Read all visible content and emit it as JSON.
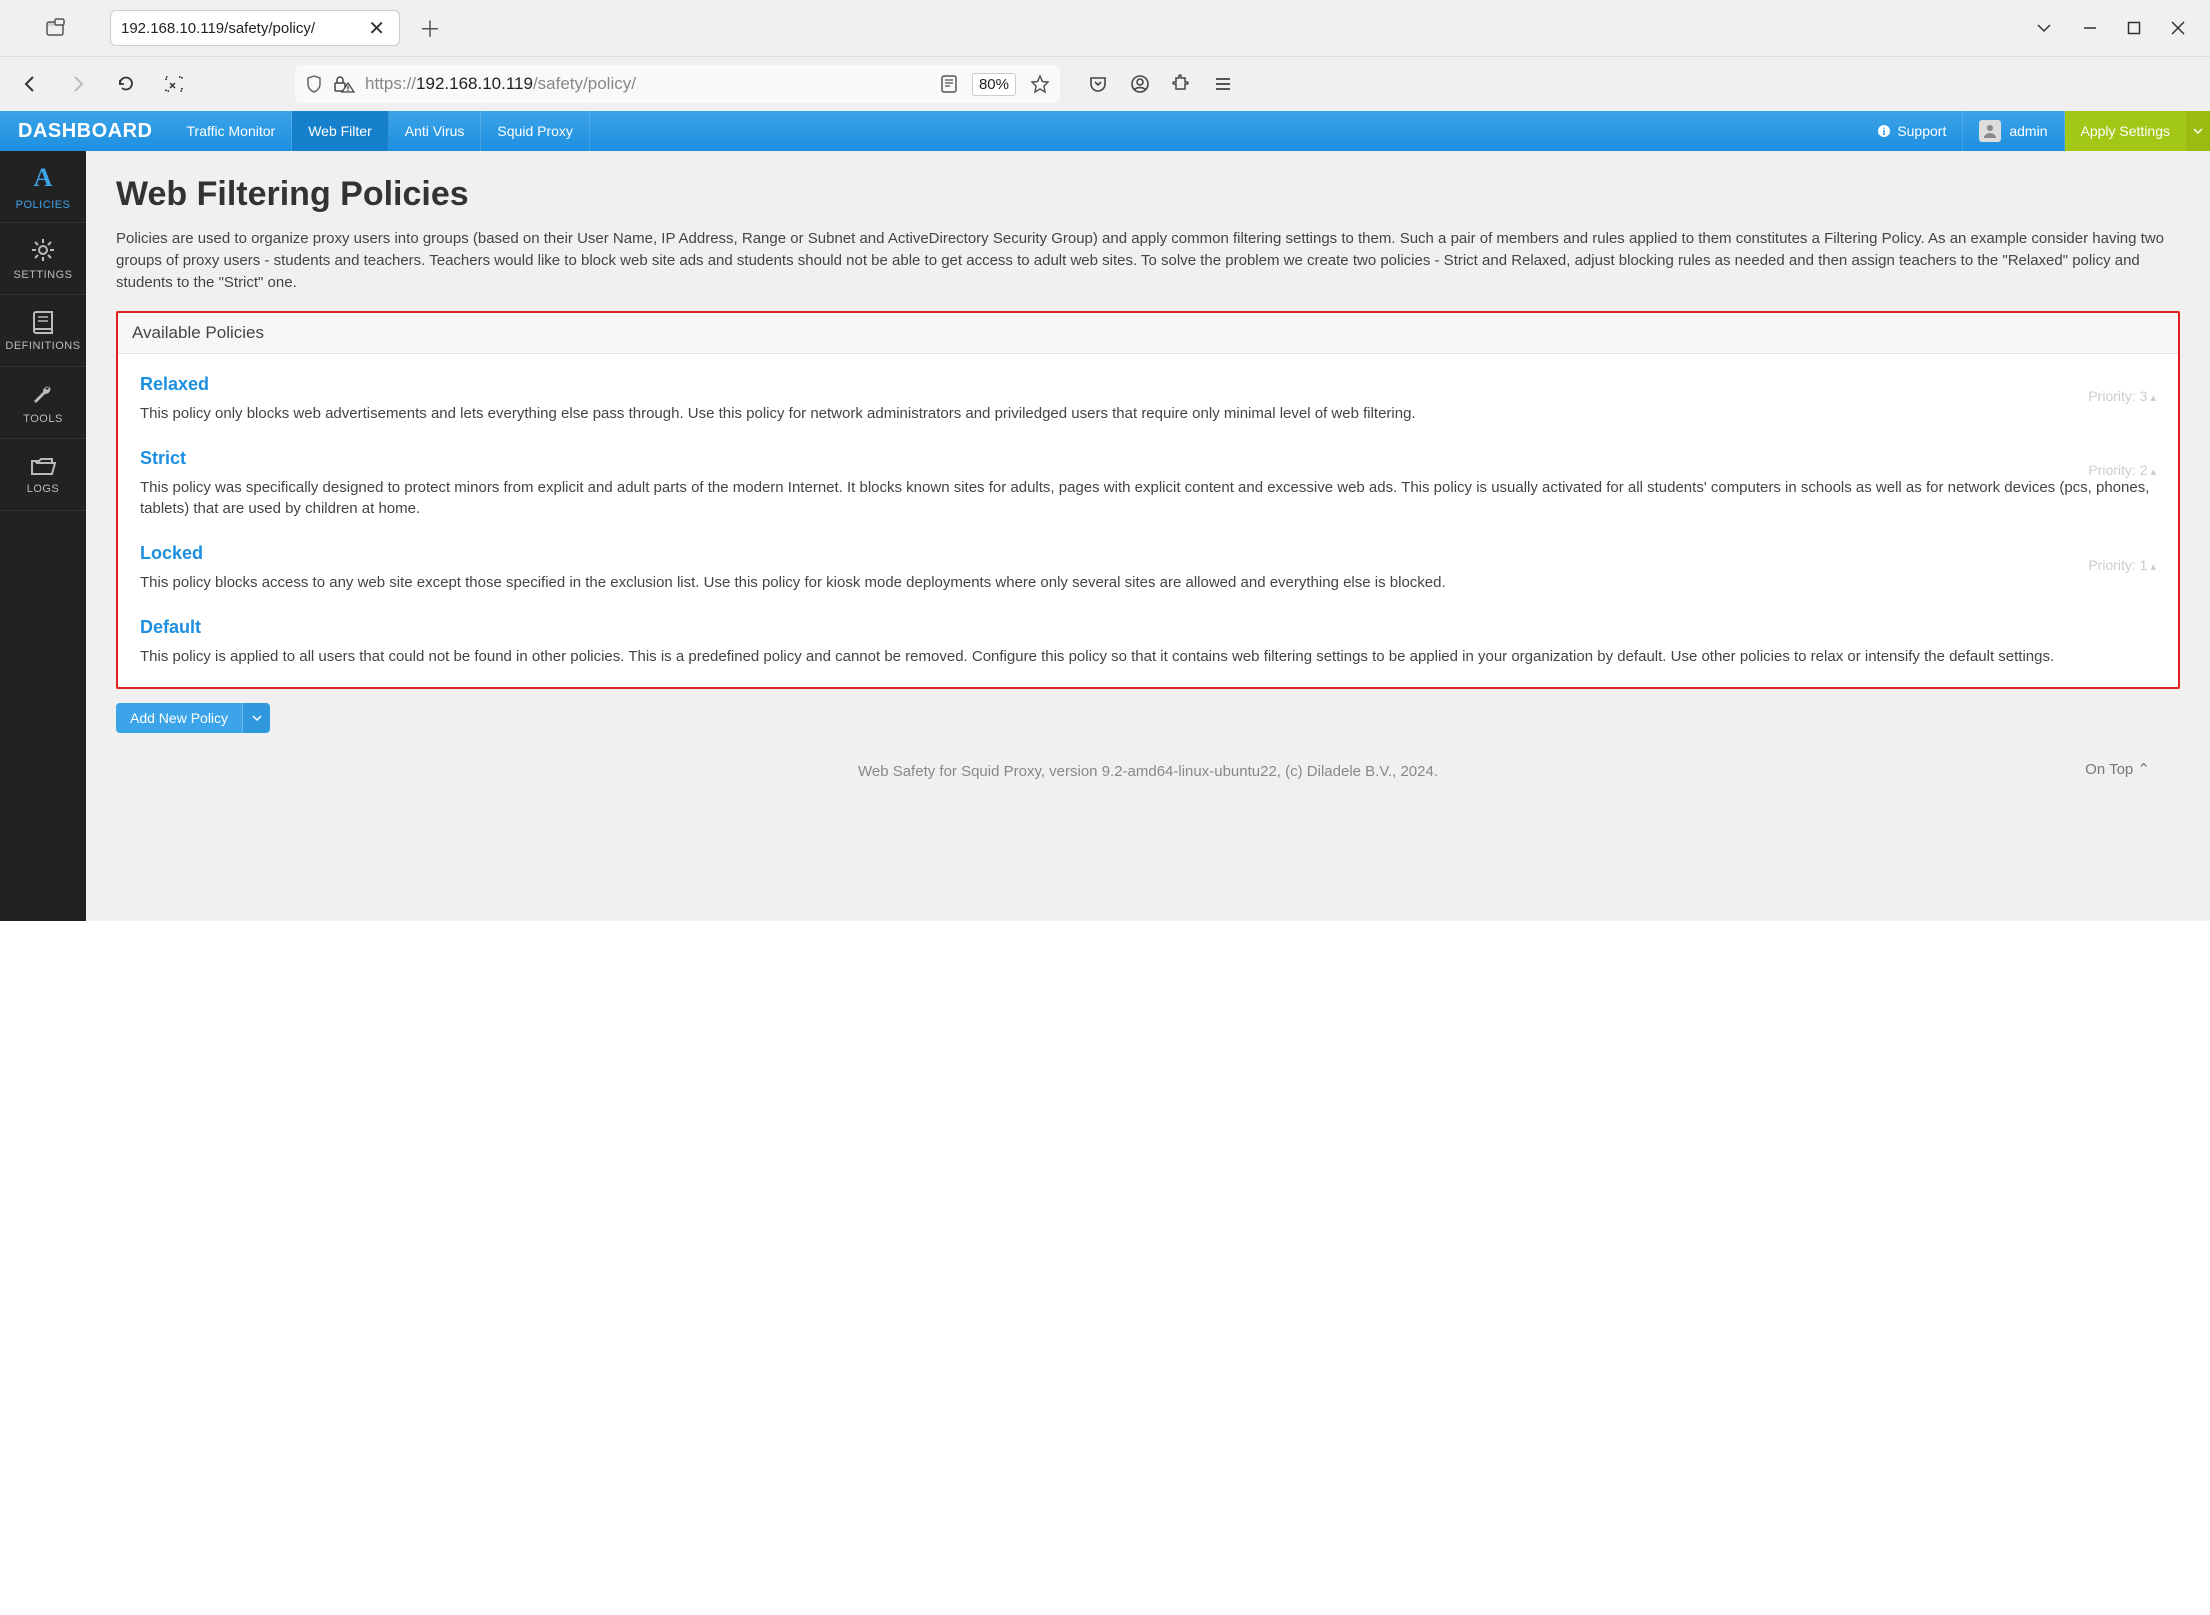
{
  "browser": {
    "tab_title": "192.168.10.119/safety/policy/",
    "url_prefix": "https://",
    "url_host": "192.168.10.119",
    "url_path": "/safety/policy/",
    "zoom": "80%"
  },
  "topnav": {
    "brand": "DASHBOARD",
    "tabs": [
      "Traffic Monitor",
      "Web Filter",
      "Anti Virus",
      "Squid Proxy"
    ],
    "active_tab_index": 1,
    "support": "Support",
    "user": "admin",
    "apply": "Apply Settings"
  },
  "sidebar": {
    "items": [
      {
        "label": "POLICIES",
        "icon": "A"
      },
      {
        "label": "SETTINGS",
        "icon": "gear"
      },
      {
        "label": "DEFINITIONS",
        "icon": "book"
      },
      {
        "label": "TOOLS",
        "icon": "wrench"
      },
      {
        "label": "LOGS",
        "icon": "folder"
      }
    ],
    "active_index": 0
  },
  "page": {
    "title": "Web Filtering Policies",
    "description": "Policies are used to organize proxy users into groups (based on their User Name, IP Address, Range or Subnet and ActiveDirectory Security Group) and apply common filtering settings to them. Such a pair of members and rules applied to them constitutes a Filtering Policy. As an example consider having two groups of proxy users - students and teachers. Teachers would like to block web site ads and students should not be able to get access to adult web sites. To solve the problem we create two policies - Strict and Relaxed, adjust blocking rules as needed and then assign teachers to the \"Relaxed\" policy and students to the \"Strict\" one.",
    "panel_title": "Available Policies",
    "policies": [
      {
        "name": "Relaxed",
        "priority": "Priority: 3",
        "desc": "This policy only blocks web advertisements and lets everything else pass through. Use this policy for network administrators and priviledged users that require only minimal level of web filtering."
      },
      {
        "name": "Strict",
        "priority": "Priority: 2",
        "desc": "This policy was specifically designed to protect minors from explicit and adult parts of the modern Internet. It blocks known sites for adults, pages with explicit content and excessive web ads. This policy is usually activated for all students' computers in schools as well as for network devices (pcs, phones, tablets) that are used by children at home."
      },
      {
        "name": "Locked",
        "priority": "Priority: 1",
        "desc": "This policy blocks access to any web site except those specified in the exclusion list. Use this policy for kiosk mode deployments where only several sites are allowed and everything else is blocked."
      },
      {
        "name": "Default",
        "priority": "",
        "desc": "This policy is applied to all users that could not be found in other policies. This is a predefined policy and cannot be removed. Configure this policy so that it contains web filtering settings to be applied in your organization by default. Use other policies to relax or intensify the default settings."
      }
    ],
    "add_policy": "Add New Policy",
    "footer": "Web Safety for Squid Proxy, version 9.2-amd64-linux-ubuntu22, (c) Diladele B.V., 2024.",
    "ontop": "On Top"
  }
}
